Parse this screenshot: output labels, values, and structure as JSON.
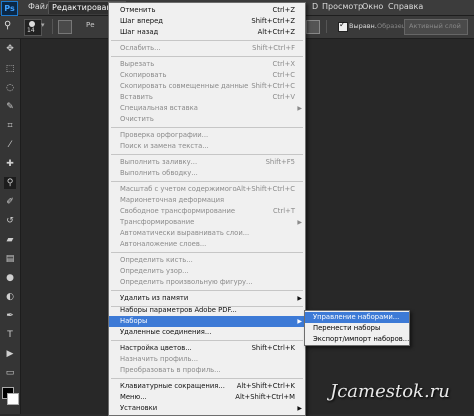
{
  "app": {
    "logo": "Ps"
  },
  "menubar": {
    "items": [
      "Файл",
      "Редактирование"
    ],
    "right_items": [
      "D",
      "Просмотр",
      "Окно",
      "Справка"
    ]
  },
  "options_bar": {
    "brush_size": "14",
    "mode_label_left": "Ре",
    "align_checkbox_label": "Выравн.",
    "sample_label": "Образец:",
    "sample_value": "Активный слой"
  },
  "edit_menu": {
    "items": [
      {
        "label": "Отменить",
        "shortcut": "Ctrl+Z",
        "disabled": false
      },
      {
        "label": "Шаг вперед",
        "shortcut": "Shift+Ctrl+Z",
        "disabled": false
      },
      {
        "label": "Шаг назад",
        "shortcut": "Alt+Ctrl+Z",
        "disabled": false
      },
      {
        "label": "Ослабить...",
        "shortcut": "Shift+Ctrl+F",
        "disabled": true
      },
      {
        "label": "Вырезать",
        "shortcut": "Ctrl+X",
        "disabled": true
      },
      {
        "label": "Скопировать",
        "shortcut": "Ctrl+C",
        "disabled": true
      },
      {
        "label": "Скопировать совмещенные данные",
        "shortcut": "Shift+Ctrl+C",
        "disabled": true
      },
      {
        "label": "Вставить",
        "shortcut": "Ctrl+V",
        "disabled": true
      },
      {
        "label": "Специальная вставка",
        "shortcut": "",
        "disabled": true
      },
      {
        "label": "Очистить",
        "shortcut": "",
        "disabled": true
      },
      {
        "label": "Проверка орфографии...",
        "shortcut": "",
        "disabled": true
      },
      {
        "label": "Поиск и замена текста...",
        "shortcut": "",
        "disabled": true
      },
      {
        "label": "Выполнить заливку...",
        "shortcut": "Shift+F5",
        "disabled": true
      },
      {
        "label": "Выполнить обводку...",
        "shortcut": "",
        "disabled": true
      },
      {
        "label": "Масштаб с учетом содержимого",
        "shortcut": "Alt+Shift+Ctrl+C",
        "disabled": true
      },
      {
        "label": "Марионеточная деформация",
        "shortcut": "",
        "disabled": true
      },
      {
        "label": "Свободное трансформирование",
        "shortcut": "Ctrl+T",
        "disabled": true
      },
      {
        "label": "Трансформирование",
        "shortcut": "",
        "disabled": true
      },
      {
        "label": "Автоматически выравнивать слои...",
        "shortcut": "",
        "disabled": true
      },
      {
        "label": "Автоналожение слоев...",
        "shortcut": "",
        "disabled": true
      },
      {
        "label": "Определить кисть...",
        "shortcut": "",
        "disabled": true
      },
      {
        "label": "Определить узор...",
        "shortcut": "",
        "disabled": true
      },
      {
        "label": "Определить произвольную фигуру...",
        "shortcut": "",
        "disabled": true
      },
      {
        "label": "Удалить из памяти",
        "shortcut": "",
        "disabled": false
      },
      {
        "label": "Наборы параметров Adobe PDF...",
        "shortcut": "",
        "disabled": false
      },
      {
        "label": "Наборы",
        "shortcut": "",
        "disabled": false
      },
      {
        "label": "Удаленные соединения...",
        "shortcut": "",
        "disabled": false
      },
      {
        "label": "Настройка цветов...",
        "shortcut": "Shift+Ctrl+K",
        "disabled": false
      },
      {
        "label": "Назначить профиль...",
        "shortcut": "",
        "disabled": true
      },
      {
        "label": "Преобразовать в профиль...",
        "shortcut": "",
        "disabled": true
      },
      {
        "label": "Клавиатурные сокращения...",
        "shortcut": "Alt+Shift+Ctrl+K",
        "disabled": false
      },
      {
        "label": "Меню...",
        "shortcut": "Alt+Shift+Ctrl+M",
        "disabled": false
      },
      {
        "label": "Установки",
        "shortcut": "",
        "disabled": false
      }
    ]
  },
  "presets_submenu": {
    "items": [
      "Управление наборами...",
      "Перенести наборы",
      "Экспорт/импорт наборов..."
    ]
  },
  "watermark": "Jcamestok.ru"
}
